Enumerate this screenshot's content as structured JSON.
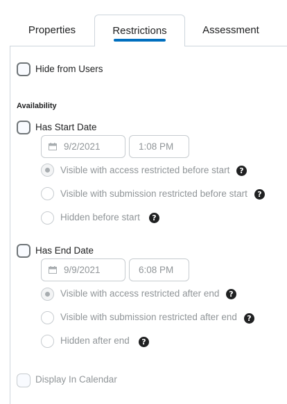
{
  "tabs": [
    {
      "label": "Properties"
    },
    {
      "label": "Restrictions",
      "active": true
    },
    {
      "label": "Assessment"
    }
  ],
  "hide_from_users": {
    "label": "Hide from Users",
    "checked": false
  },
  "availability": {
    "title": "Availability",
    "start": {
      "label": "Has Start Date",
      "checked": false,
      "date": "9/2/2021",
      "time": "1:08 PM",
      "options": [
        {
          "label": "Visible with access restricted before start",
          "selected": true
        },
        {
          "label": "Visible with submission restricted before start",
          "selected": false
        },
        {
          "label": "Hidden before start",
          "selected": false
        }
      ]
    },
    "end": {
      "label": "Has End Date",
      "checked": false,
      "date": "9/9/2021",
      "time": "6:08 PM",
      "options": [
        {
          "label": "Visible with access restricted after end",
          "selected": true
        },
        {
          "label": "Visible with submission restricted after end",
          "selected": false
        },
        {
          "label": "Hidden after end",
          "selected": false
        }
      ]
    }
  },
  "display_in_calendar": {
    "label": "Display In Calendar",
    "checked": false,
    "disabled": true
  },
  "icons": {
    "help": "?",
    "calendar": "calendar-icon"
  },
  "colors": {
    "accent": "#006fbf",
    "text": "#202122",
    "muted": "#909598",
    "border": "#cdd5dc"
  }
}
